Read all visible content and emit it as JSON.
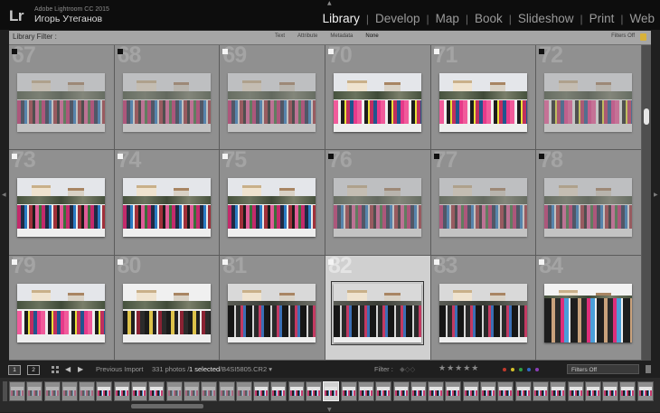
{
  "identity": {
    "logo": "Lr",
    "app_name": "Adobe Lightroom CC 2015",
    "user_name": "Игорь Утеганов"
  },
  "modules": [
    "Library",
    "Develop",
    "Map",
    "Book",
    "Slideshow",
    "Print",
    "Web"
  ],
  "active_module": "Library",
  "filter_bar": {
    "title": "Library Filter :",
    "tabs": [
      "Text",
      "Attribute",
      "Metadata",
      "None"
    ],
    "active_tab": "None",
    "filters_off": "Filters Off"
  },
  "grid": {
    "cells": [
      {
        "index": "67",
        "flag": "black",
        "dim": true,
        "variant": "v1"
      },
      {
        "index": "68",
        "flag": "black",
        "dim": true,
        "variant": "v1"
      },
      {
        "index": "69",
        "flag": "white",
        "dim": true,
        "variant": "v1"
      },
      {
        "index": "70",
        "flag": "white",
        "dim": false,
        "variant": "v2"
      },
      {
        "index": "71",
        "flag": "white",
        "dim": false,
        "variant": "v2"
      },
      {
        "index": "72",
        "flag": "black",
        "dim": true,
        "variant": "v2"
      },
      {
        "index": "73",
        "flag": "white",
        "dim": false,
        "variant": "v1"
      },
      {
        "index": "74",
        "flag": "white",
        "dim": false,
        "variant": "v1"
      },
      {
        "index": "75",
        "flag": "white",
        "dim": false,
        "variant": "v1"
      },
      {
        "index": "76",
        "flag": "black",
        "dim": true,
        "variant": "v1"
      },
      {
        "index": "77",
        "flag": "black",
        "dim": true,
        "variant": "v1"
      },
      {
        "index": "78",
        "flag": "black",
        "dim": true,
        "variant": "v1"
      },
      {
        "index": "79",
        "flag": "white",
        "dim": false,
        "variant": "v2"
      },
      {
        "index": "80",
        "flag": "white",
        "dim": false,
        "variant": "v3"
      },
      {
        "index": "81",
        "flag": "white",
        "dim": false,
        "variant": "v4"
      },
      {
        "index": "82",
        "flag": "white",
        "dim": false,
        "variant": "v4",
        "selected": true
      },
      {
        "index": "83",
        "flag": "white",
        "dim": false,
        "variant": "v4"
      },
      {
        "index": "84",
        "flag": "white",
        "dim": false,
        "variant": "v5"
      }
    ]
  },
  "filmstrip_bar": {
    "screen_1": "1",
    "screen_2": "2",
    "source": "Previous Import",
    "photo_count": "331 photos /",
    "selected_count": "1 selected",
    "filename": "/B4SI5805.CR2 ▾",
    "filter_label": "Filter :",
    "stars": "★★★★★",
    "filters_select": "Filters Off",
    "color_dots": [
      "#c0392b",
      "#d4c02a",
      "#2e9e45",
      "#2f68c2",
      "#8a3fb5"
    ]
  },
  "filmstrip": {
    "frame_count": 37,
    "selected_frame": 18,
    "dim_frames": [
      0,
      1,
      2,
      3,
      4,
      9,
      10,
      11,
      12,
      13
    ]
  },
  "icons": {
    "top_expand": "triangle-up-icon",
    "left_panel": "triangle-left-icon",
    "right_panel": "triangle-right-icon",
    "grid_view": "grid-view-icon",
    "lock": "lock-icon"
  }
}
